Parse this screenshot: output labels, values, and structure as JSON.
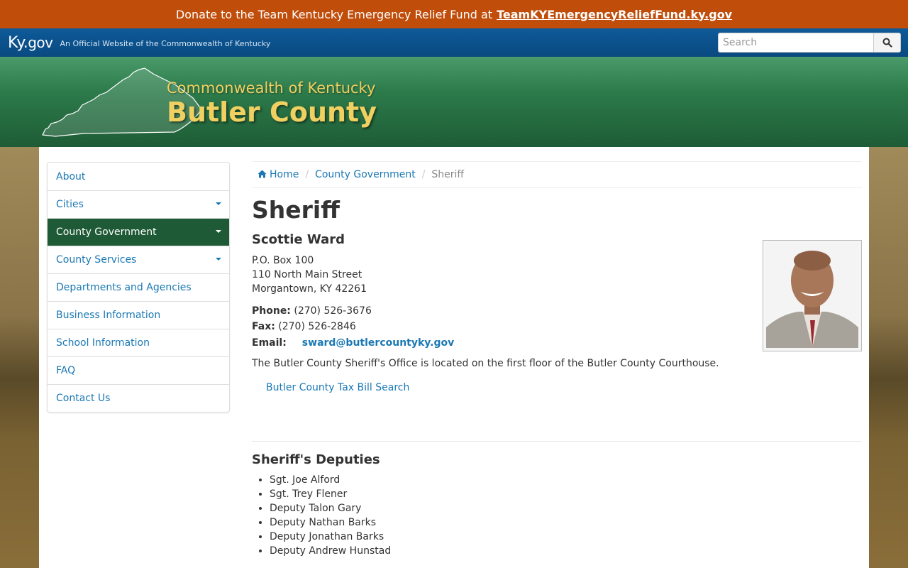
{
  "donate": {
    "text": "Donate to the Team Kentucky Emergency Relief Fund at",
    "link": "TeamKYEmergencyReliefFund.ky.gov"
  },
  "kygov": {
    "logo_ky": "Ky.",
    "logo_gov": "gov",
    "tagline": "An Official Website of the Commonwealth of Kentucky",
    "search_placeholder": "Search",
    "search_icon": "search-icon"
  },
  "header": {
    "commonwealth": "Commonwealth of Kentucky",
    "county": "Butler County"
  },
  "sidebar": {
    "items": [
      {
        "label": "About",
        "dropdown": false,
        "active": false
      },
      {
        "label": "Cities",
        "dropdown": true,
        "active": false
      },
      {
        "label": "County Government",
        "dropdown": true,
        "active": true
      },
      {
        "label": "County Services",
        "dropdown": true,
        "active": false
      },
      {
        "label": "Departments and Agencies",
        "dropdown": false,
        "active": false
      },
      {
        "label": "Business Information",
        "dropdown": false,
        "active": false
      },
      {
        "label": "School Information",
        "dropdown": false,
        "active": false
      },
      {
        "label": "FAQ",
        "dropdown": false,
        "active": false
      },
      {
        "label": "Contact Us",
        "dropdown": false,
        "active": false
      }
    ]
  },
  "breadcrumb": {
    "home": "Home",
    "section": "County Government",
    "current": "Sheriff",
    "separator": "/"
  },
  "main": {
    "title": "Sheriff",
    "name": "Scottie Ward",
    "address": [
      "P.O. Box 100",
      "110 North Main Street",
      "Morgantown, KY 42261"
    ],
    "phone_label": "Phone:",
    "phone": "(270) 526-3676",
    "fax_label": "Fax:",
    "fax": "(270) 526-2846",
    "email_label": "Email:",
    "email": "sward@butlercountyky.gov",
    "description": "The Butler County Sheriff's Office is located on the first floor of the Butler County Courthouse.",
    "tax_link": "Butler County Tax Bill Search",
    "deputies_title": "Sheriff's Deputies",
    "deputies": [
      "Sgt. Joe Alford",
      "Sgt. Trey Flener",
      "Deputy Talon Gary",
      "Deputy Nathan Barks",
      "Deputy Jonathan Barks",
      "Deputy Andrew Hunstad"
    ]
  },
  "colors": {
    "donate_bg": "#c04d0a",
    "kybar_bg": "#0a4a80",
    "header_green": "#2c7a4a",
    "title_gold": "#f0d060",
    "active_nav": "#1f5a36",
    "link": "#1a78b4"
  }
}
